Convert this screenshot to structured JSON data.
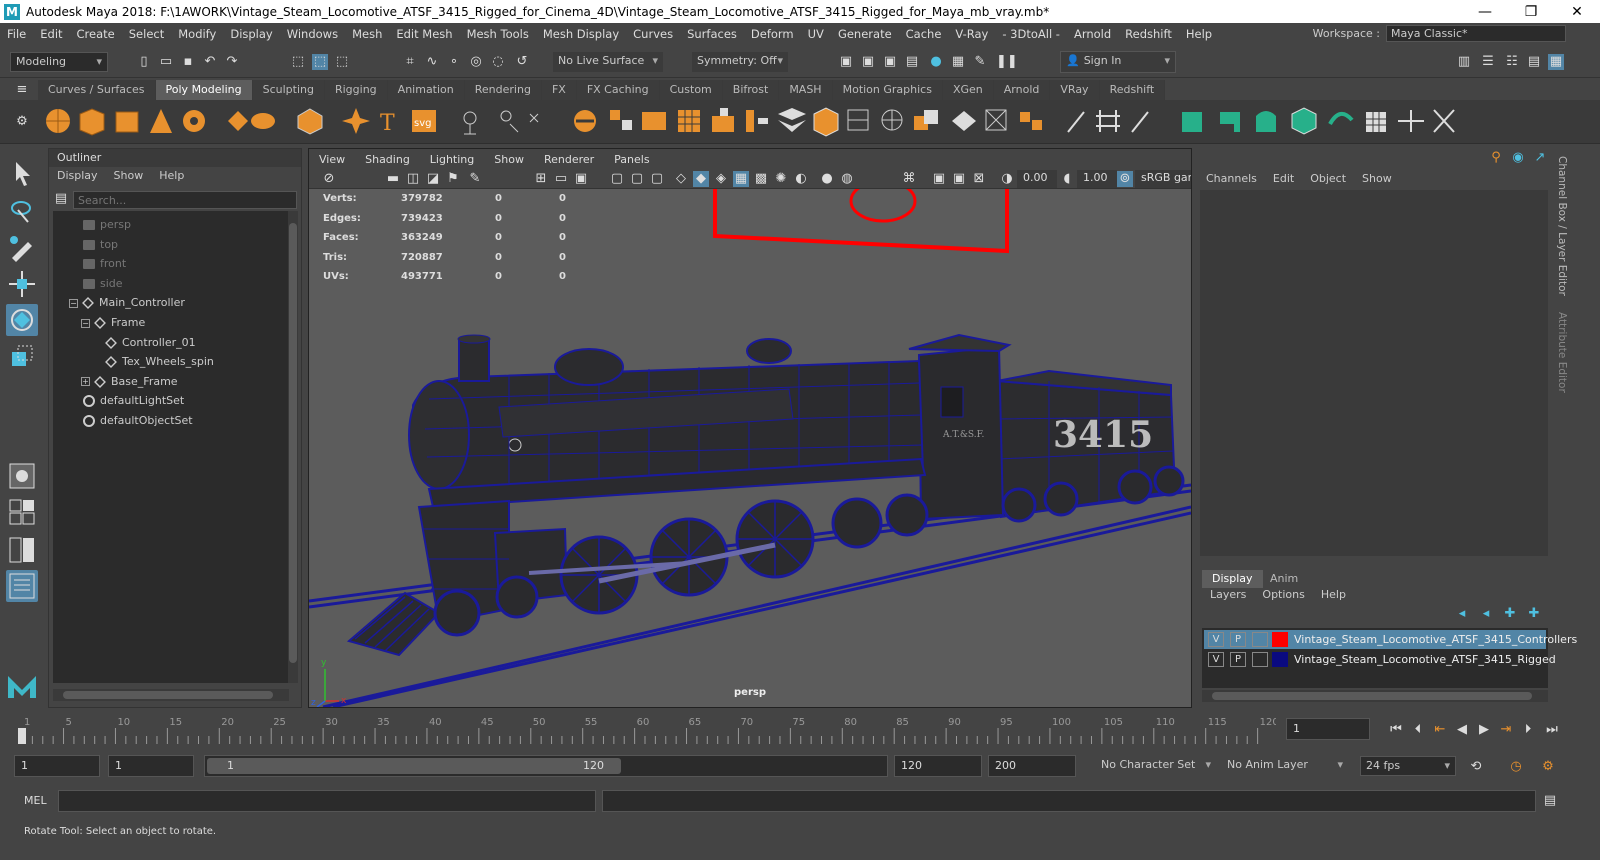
{
  "title_bar": {
    "logo": "M",
    "title": "Autodesk Maya 2018: F:\\1AWORK\\Vintage_Steam_Locomotive_ATSF_3415_Rigged_for_Cinema_4D\\Vintage_Steam_Locomotive_ATSF_3415_Rigged_for_Maya_mb_vray.mb*",
    "minimize": "—",
    "restore": "❐",
    "close": "✕"
  },
  "menubar": {
    "items": [
      "File",
      "Edit",
      "Create",
      "Select",
      "Modify",
      "Display",
      "Windows",
      "Mesh",
      "Edit Mesh",
      "Mesh Tools",
      "Mesh Display",
      "Curves",
      "Surfaces",
      "Deform",
      "UV",
      "Generate",
      "Cache",
      "V-Ray",
      "- 3DtoAll -",
      "Arnold",
      "Redshift",
      "Help"
    ],
    "workspace_label": "Workspace :",
    "workspace_value": "Maya Classic*"
  },
  "status_line": {
    "mode": "Modeling",
    "live_surface": "No Live Surface",
    "symmetry": "Symmetry: Off",
    "sign_in": "Sign In"
  },
  "shelf": {
    "tabs": [
      "Curves / Surfaces",
      "Poly Modeling",
      "Sculpting",
      "Rigging",
      "Animation",
      "Rendering",
      "FX",
      "FX Caching",
      "Custom",
      "Bifrost",
      "MASH",
      "Motion Graphics",
      "XGen",
      "Arnold",
      "VRay",
      "Redshift"
    ],
    "active_tab": "Poly Modeling",
    "text_icon": "T",
    "svg_icon": "svg"
  },
  "outliner": {
    "title": "Outliner",
    "menu": [
      "Display",
      "Show",
      "Help"
    ],
    "search_placeholder": "Search...",
    "items": [
      {
        "label": "persp",
        "type": "camera"
      },
      {
        "label": "top",
        "type": "camera"
      },
      {
        "label": "front",
        "type": "camera"
      },
      {
        "label": "side",
        "type": "camera"
      },
      {
        "label": "Main_Controller",
        "type": "transform"
      },
      {
        "label": "Frame",
        "type": "transform"
      },
      {
        "label": "Controller_01",
        "type": "transform"
      },
      {
        "label": "Tex_Wheels_spin",
        "type": "transform"
      },
      {
        "label": "Base_Frame",
        "type": "transform"
      },
      {
        "label": "defaultLightSet",
        "type": "set"
      },
      {
        "label": "defaultObjectSet",
        "type": "set"
      }
    ]
  },
  "viewport": {
    "menu": [
      "View",
      "Shading",
      "Lighting",
      "Show",
      "Renderer",
      "Panels"
    ],
    "exposure": "0.00",
    "gamma": "1.00",
    "colorspace": "sRGB gamma",
    "camera": "persp",
    "hud": [
      {
        "label": "Verts:",
        "a": "379782",
        "b": "0",
        "c": "0"
      },
      {
        "label": "Edges:",
        "a": "739423",
        "b": "0",
        "c": "0"
      },
      {
        "label": "Faces:",
        "a": "363249",
        "b": "0",
        "c": "0"
      },
      {
        "label": "Tris:",
        "a": "720887",
        "b": "0",
        "c": "0"
      },
      {
        "label": "UVs:",
        "a": "493771",
        "b": "0",
        "c": "0"
      }
    ],
    "locomotive_number": "3415",
    "cab_lettering": "A.T.&S.F.",
    "axis_x": "x",
    "axis_y": "y",
    "axis_z": "z"
  },
  "channel_box": {
    "menu": [
      "Channels",
      "Edit",
      "Object",
      "Show"
    ]
  },
  "side_tabs": {
    "channel_box": "Channel Box / Layer Editor",
    "attribute_editor": "Attribute Editor"
  },
  "layer_editor": {
    "tabs": [
      "Display",
      "Anim"
    ],
    "active_tab": "Display",
    "menu": [
      "Layers",
      "Options",
      "Help"
    ],
    "layers": [
      {
        "v": "V",
        "p": "P",
        "color": "#ff0000",
        "name": "Vintage_Steam_Locomotive_ATSF_3415_Controllers",
        "selected": true
      },
      {
        "v": "V",
        "p": "P",
        "color": "#0a0a80",
        "name": "Vintage_Steam_Locomotive_ATSF_3415_Rigged",
        "selected": false
      }
    ]
  },
  "time_slider": {
    "ticks": [
      "1",
      "5",
      "10",
      "15",
      "20",
      "25",
      "30",
      "35",
      "40",
      "45",
      "50",
      "55",
      "60",
      "65",
      "70",
      "75",
      "80",
      "85",
      "90",
      "95",
      "100",
      "105",
      "110",
      "115",
      "120"
    ],
    "current_frame": "1"
  },
  "range_slider": {
    "start": "1",
    "playback_start": "1",
    "range_start": "1",
    "range_end": "120",
    "playback_end": "120",
    "end": "200",
    "character_set": "No Character Set",
    "anim_layer": "No Anim Layer",
    "fps": "24 fps"
  },
  "command_line": {
    "label": "MEL"
  },
  "help_line": {
    "text": "Rotate Tool: Select an object to rotate."
  },
  "colors": {
    "wire": "#1a1a9a",
    "controller": "#ff0000",
    "accent_orange": "#e8912e",
    "select_blue": "#5285a6"
  }
}
